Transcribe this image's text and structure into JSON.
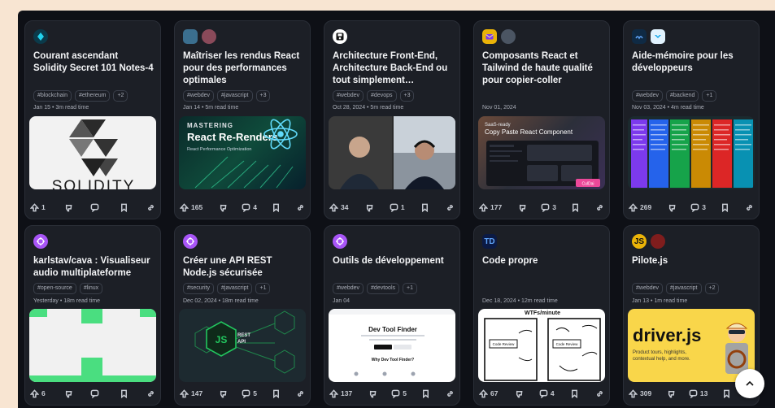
{
  "cards": [
    {
      "id": "solidity",
      "title": "Courant ascendant Solidity Secret 101 Notes-4",
      "tags": [
        "#blockchain",
        "#ethereum",
        "+2"
      ],
      "meta": "Jan 15 • 3m read time",
      "cover_text": "SOLIDITY",
      "upvotes": "1",
      "comments": ""
    },
    {
      "id": "react-renders",
      "title": "Maîtriser les rendus React pour des performances optimales",
      "tags": [
        "#webdev",
        "#javascript",
        "+3"
      ],
      "meta": "Jan 14 • 5m read time",
      "cover_line1": "MASTERING",
      "cover_line2": "React Re-Renders",
      "cover_line3": "React Performance Optimization",
      "upvotes": "165",
      "comments": "4"
    },
    {
      "id": "architecture",
      "title": "Architecture Front-End, Architecture Back-End ou tout simplement…",
      "tags": [
        "#webdev",
        "#devops",
        "+3"
      ],
      "meta": "Oct 28, 2024 • 5m read time",
      "upvotes": "34",
      "comments": "1"
    },
    {
      "id": "tailwind",
      "title": "Composants React et Tailwind de haute qualité pour copier-coller",
      "tags": [],
      "meta": "Nov 01, 2024",
      "cover_line1": "SaaS-ready",
      "cover_line2": "Copy Paste React Component",
      "cover_badge": "CulDai",
      "upvotes": "177",
      "comments": "3"
    },
    {
      "id": "aide-memoire",
      "title": "Aide-mémoire pour les développeurs",
      "tags": [
        "#webdev",
        "#backend",
        "+1"
      ],
      "meta": "Nov 03, 2024 • 4m read time",
      "upvotes": "269",
      "comments": "3"
    },
    {
      "id": "cava",
      "title": "karlstav/cava : Visualiseur audio multiplateforme",
      "tags": [
        "#open-source",
        "#linux"
      ],
      "meta": "Yesterday • 18m read time",
      "upvotes": "6",
      "comments": ""
    },
    {
      "id": "api-node",
      "title": "Créer une API REST Node.js sécurisée",
      "tags": [
        "#security",
        "#javascript",
        "+1"
      ],
      "meta": "Dec 02, 2024 • 18m read time",
      "cover_line1": "REST",
      "cover_line2": "API",
      "upvotes": "147",
      "comments": "5"
    },
    {
      "id": "devtools",
      "title": "Outils de développement",
      "tags": [
        "#webdev",
        "#devtools",
        "+1"
      ],
      "meta": "Jan 04",
      "cover_line1": "Dev Tool Finder",
      "cover_line2": "Why Dev Tool Finder?",
      "upvotes": "137",
      "comments": "5"
    },
    {
      "id": "code-propre",
      "title": "Code propre",
      "tags": [],
      "meta": "Dec 18, 2024 • 12m read time",
      "cover_line1": "WTFs/minute",
      "cover_line2": "Code Review",
      "cover_line3": "Code Review",
      "upvotes": "67",
      "comments": "4"
    },
    {
      "id": "pilote",
      "title": "Pilote.js",
      "tags": [
        "#webdev",
        "#javascript",
        "+2"
      ],
      "meta": "Jan 13 • 1m read time",
      "cover_line1": "driver.js",
      "cover_line2": "Product tours, highlights, contextual help, and more.",
      "upvotes": "309",
      "comments": "13"
    }
  ],
  "avatars": {
    "td": "TD",
    "js": "JS"
  },
  "colors": {
    "page_bg": "#f8e5d2",
    "board_bg": "#0e1016",
    "card_bg": "#1c1f26",
    "purple_avatar": "#a855f7",
    "teal_avatar": "#0f766e"
  }
}
